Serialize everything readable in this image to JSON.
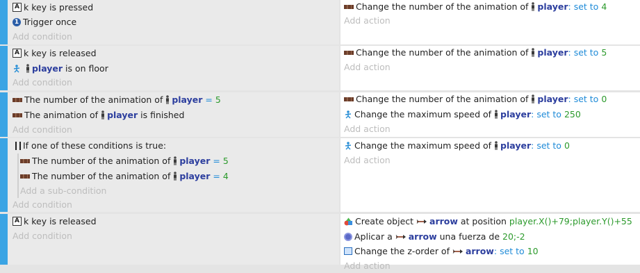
{
  "events": [
    {
      "conditions": [
        {
          "icon": "key-icon",
          "key_letter": "A",
          "text": "k key is pressed"
        },
        {
          "icon": "trigger-once-icon",
          "once_digit": "1",
          "text": "Trigger once"
        }
      ],
      "add_condition": "Add condition",
      "actions": [
        {
          "text": "Change the number of the animation of ",
          "object": "player",
          "sep": ":",
          "kw": "set to",
          "value": "4"
        }
      ],
      "add_action": "Add action"
    },
    {
      "conditions": [
        {
          "icon": "key-icon",
          "key_letter": "A",
          "text": "k key is released"
        },
        {
          "icon": "platformer-icon",
          "object": "player",
          "text": " is on floor"
        }
      ],
      "add_condition": "Add condition",
      "actions": [
        {
          "text": "Change the number of the animation of ",
          "object": "player",
          "sep": ":",
          "kw": "set to",
          "value": "5"
        }
      ],
      "add_action": "Add action"
    },
    {
      "conditions": [
        {
          "icon": "animation-icon",
          "text": "The number of the animation of ",
          "object": "player",
          "op": "=",
          "value": "5"
        },
        {
          "icon": "animation-icon",
          "text": "The animation of ",
          "object": "player",
          "text2": " is finished"
        }
      ],
      "add_condition": "Add condition",
      "actions": [
        {
          "text": "Change the number of the animation of ",
          "object": "player",
          "sep": ":",
          "kw": "set to",
          "value": "0"
        },
        {
          "text": "Change the maximum speed of ",
          "object": "player",
          "sep": ":",
          "kw": "set to",
          "value": "250"
        }
      ],
      "add_action": "Add action"
    },
    {
      "or_header": "If one of these conditions is true:",
      "sub_conditions": [
        {
          "text": "The number of the animation of ",
          "object": "player",
          "op": "=",
          "value": "5"
        },
        {
          "text": "The number of the animation of ",
          "object": "player",
          "op": "=",
          "value": "4"
        }
      ],
      "add_sub_condition": "Add a sub-condition",
      "add_condition": "Add condition",
      "actions": [
        {
          "text": "Change the maximum speed of ",
          "object": "player",
          "sep": ":",
          "kw": "set to",
          "value": "0"
        }
      ],
      "add_action": "Add action"
    },
    {
      "conditions": [
        {
          "icon": "key-icon",
          "key_letter": "A",
          "text": "k key is released"
        }
      ],
      "add_condition": "Add condition",
      "actions": [
        {
          "text": "Create object ",
          "object": "arrow",
          "text2": " at position ",
          "value": "player.X()+79;player.Y()+55"
        },
        {
          "text": "Aplicar a ",
          "object": "arrow",
          "text2": " una fuerza de ",
          "value": "20;-2"
        },
        {
          "text": "Change the z-order of ",
          "object": "arrow",
          "sep": ":",
          "kw": "set to",
          "value": "10"
        }
      ],
      "add_action": "Add action"
    }
  ],
  "colors": {
    "event_bar": "#3aa4e4",
    "condition_bg": "#eaeaea",
    "action_bg": "#ffffff",
    "object_name": "#2c3e9e",
    "keyword": "#1f8bd8",
    "value": "#2c9a2c",
    "placeholder": "#bdbdbd"
  }
}
